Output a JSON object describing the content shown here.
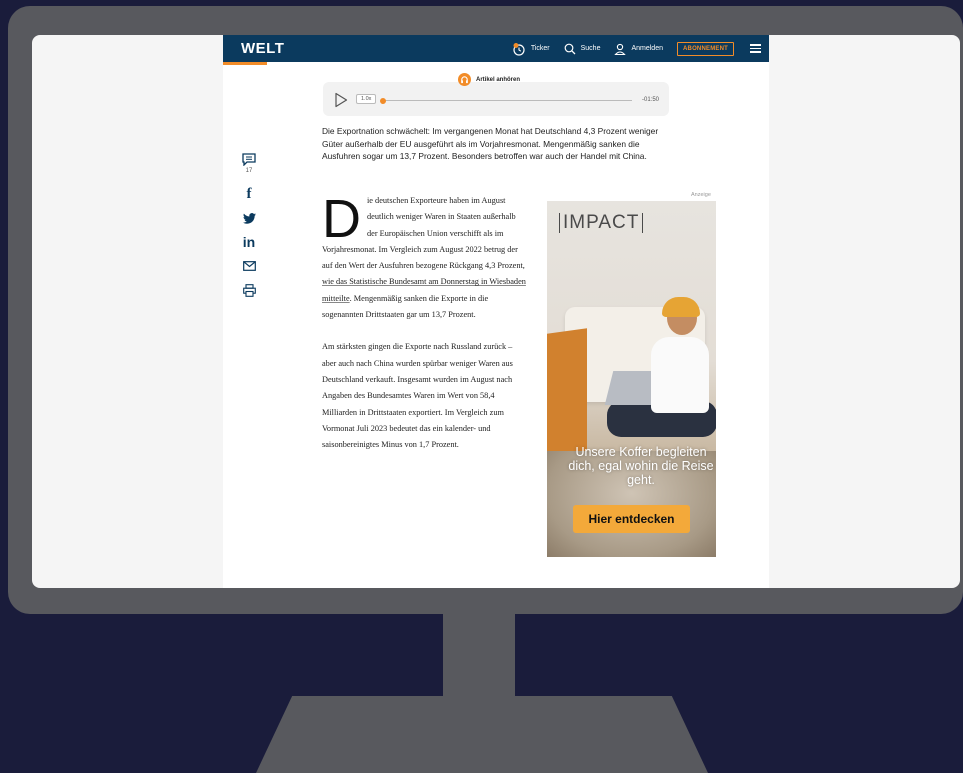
{
  "header": {
    "logo": "WELT",
    "nav": {
      "ticker": "Ticker",
      "search": "Suche",
      "login": "Anmelden",
      "subscription": "ABONNEMENT"
    }
  },
  "audio_player": {
    "label": "Artikel anhören",
    "speed": "1.0x",
    "remaining_time": "-01:50",
    "progress": 0
  },
  "article": {
    "lead": "Die Exportnation schwächelt: Im vergangenen Monat hat Deutschland 4,3 Prozent weniger Güter außerhalb der EU ausgeführt als im Vorjahresmonat. Mengenmäßig sanken die Ausfuhren sogar um 13,7 Prozent. Besonders betroffen war auch der Handel mit China.",
    "dropcap": "D",
    "p1_start": "ie deutschen Exporteure haben im August deutlich weniger Waren in Staaten außerhalb der Europäischen Union verschifft als im Vorjahresmonat. Im Vergleich zum August 2022 betrug der auf den Wert der Ausfuhren bezogene Rückgang 4,3 Prozent, ",
    "p1_link": "wie das Statistische Bundesamt am Donnerstag in Wiesbaden mitteilte",
    "p1_end": ". Mengenmäßig sanken die Exporte in die sogenannten Drittstaaten gar um 13,7 Prozent.",
    "p2": "Am stärksten gingen die Exporte nach Russland zurück – aber auch nach China wurden spürbar weniger Waren aus Deutschland verkauft. Insgesamt wurden im August nach Angaben des Bundesamtes Waren im Wert von 58,4 Milliarden in Drittstaaten exportiert. Im Vergleich zum Vormonat Juli 2023 bedeutet das ein kalender- und saisonbereinigtes Minus von 1,7 Prozent."
  },
  "share": {
    "comments_count": "17",
    "facebook": "f",
    "linkedin": "in"
  },
  "ad": {
    "label": "Anzeige",
    "brand": "IMPACT",
    "headline": "Unsere Koffer begleiten dich, egal wohin die Reise geht.",
    "cta": "Hier entdecken"
  },
  "colors": {
    "brand_navy": "#0b3a5e",
    "accent_orange": "#f28c28",
    "background": "#1a1c3b",
    "monitor": "#58595e"
  }
}
